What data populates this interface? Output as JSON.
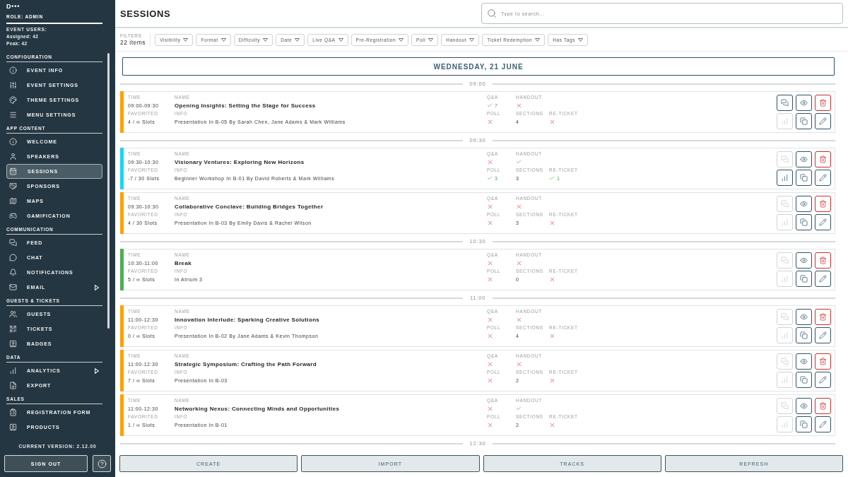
{
  "sidebar": {
    "account": {
      "name": "D•••",
      "role": "ROLE: ADMIN"
    },
    "event_users": {
      "title": "EVENT USERS:",
      "assigned": "Assigned: 42",
      "peak": "Peak: 42"
    },
    "sections": [
      {
        "title": "CONFIGURATION",
        "items": [
          {
            "label": "EVENT INFO",
            "selected": false,
            "submenu": false
          },
          {
            "label": "EVENT SETTINGS",
            "selected": false,
            "submenu": false
          },
          {
            "label": "THEME SETTINGS",
            "selected": false,
            "submenu": false
          },
          {
            "label": "MENU SETTINGS",
            "selected": false,
            "submenu": false
          }
        ]
      },
      {
        "title": "APP CONTENT",
        "items": [
          {
            "label": "WELCOME",
            "selected": false,
            "submenu": false
          },
          {
            "label": "SPEAKERS",
            "selected": false,
            "submenu": false
          },
          {
            "label": "SESSIONS",
            "selected": true,
            "submenu": false
          },
          {
            "label": "SPONSORS",
            "selected": false,
            "submenu": false
          },
          {
            "label": "MAPS",
            "selected": false,
            "submenu": false
          },
          {
            "label": "GAMIFICATION",
            "selected": false,
            "submenu": false
          }
        ]
      },
      {
        "title": "COMMUNICATION",
        "items": [
          {
            "label": "FEED",
            "selected": false,
            "submenu": false
          },
          {
            "label": "CHAT",
            "selected": false,
            "submenu": false
          },
          {
            "label": "NOTIFICATIONS",
            "selected": false,
            "submenu": false
          },
          {
            "label": "EMAIL",
            "selected": false,
            "submenu": true
          }
        ]
      },
      {
        "title": "GUESTS & TICKETS",
        "items": [
          {
            "label": "GUESTS",
            "selected": false,
            "submenu": false
          },
          {
            "label": "TICKETS",
            "selected": false,
            "submenu": false
          },
          {
            "label": "BADGES",
            "selected": false,
            "submenu": false
          }
        ]
      },
      {
        "title": "DATA",
        "items": [
          {
            "label": "ANALYTICS",
            "selected": false,
            "submenu": true
          },
          {
            "label": "EXPORT",
            "selected": false,
            "submenu": false
          }
        ]
      },
      {
        "title": "SALES",
        "items": [
          {
            "label": "REGISTRATION FORM",
            "selected": false,
            "submenu": false
          },
          {
            "label": "PRODUCTS",
            "selected": false,
            "submenu": false
          }
        ]
      }
    ],
    "version": "CURRENT VERSION: 2.12.00",
    "sign_out": "SIGN OUT"
  },
  "header": {
    "title": "SESSIONS",
    "search": {
      "placeholder": "Type to search..."
    }
  },
  "filters": {
    "label": "FILTERS",
    "count": "22 items",
    "chips": [
      {
        "label": "Visibility"
      },
      {
        "label": "Format"
      },
      {
        "label": "Difficulty"
      },
      {
        "label": "Date"
      },
      {
        "label": "Live Q&A"
      },
      {
        "label": "Pre-Registration"
      },
      {
        "label": "Poll"
      },
      {
        "label": "Handout"
      },
      {
        "label": "Ticket Redemption"
      },
      {
        "label": "Has Tags"
      }
    ]
  },
  "day": {
    "title": "WEDNESDAY, 21 JUNE",
    "slots": [
      {
        "time": "09:00",
        "sessions": [
          {
            "color": "#ffa000",
            "time": {
              "label": "TIME",
              "value": "09:00-09:30"
            },
            "favorited": {
              "label": "FAVORITED",
              "value": "4 / ∞ Slots"
            },
            "name": {
              "label": "NAME",
              "value": "Opening Insights: Setting the Stage for Success"
            },
            "info": {
              "label": "INFO",
              "value": "Presentation In B-05 By Sarah Chen, Jane Adams & Mark Williams"
            },
            "qa": {
              "label": "Q&A",
              "on": true,
              "count": "7"
            },
            "handout": {
              "label": "HANDOUT",
              "on": false
            },
            "poll": {
              "label": "POLL",
              "on": false
            },
            "sections": {
              "label": "SECTIONS",
              "value": "4"
            },
            "reticket": {
              "label": "RE-TICKET",
              "on": false
            },
            "actions": [
              {
                "kind": "chat",
                "disabled": false
              },
              {
                "kind": "view",
                "disabled": false
              },
              {
                "kind": "delete",
                "disabled": false
              },
              {
                "kind": "chart",
                "disabled": true
              },
              {
                "kind": "copy",
                "disabled": false
              },
              {
                "kind": "edit",
                "disabled": false
              }
            ]
          }
        ]
      },
      {
        "time": "09:30",
        "sessions": [
          {
            "color": "#1ed2f4",
            "time": {
              "label": "TIME",
              "value": "09:30-10:30"
            },
            "favorited": {
              "label": "FAVORITED",
              "value": "-7 / 30 Slots"
            },
            "name": {
              "label": "NAME",
              "value": "Visionary Ventures: Exploring New Horizons"
            },
            "info": {
              "label": "INFO",
              "value": "Beginner Workshop In B-01 By David Roberts & Mark Williams"
            },
            "qa": {
              "label": "Q&A",
              "on": false
            },
            "handout": {
              "label": "HANDOUT",
              "on": true
            },
            "poll": {
              "label": "POLL",
              "on": true,
              "count": "3"
            },
            "sections": {
              "label": "SECTIONS",
              "value": "3"
            },
            "reticket": {
              "label": "RE-TICKET",
              "on": true,
              "count": "1"
            },
            "actions": [
              {
                "kind": "chat",
                "disabled": true
              },
              {
                "kind": "view",
                "disabled": false
              },
              {
                "kind": "delete",
                "disabled": false
              },
              {
                "kind": "chart",
                "disabled": false
              },
              {
                "kind": "copy",
                "disabled": false
              },
              {
                "kind": "edit",
                "disabled": false
              }
            ]
          },
          {
            "color": "#ffa000",
            "time": {
              "label": "TIME",
              "value": "09:30-10:30"
            },
            "favorited": {
              "label": "FAVORITED",
              "value": "4 / 30 Slots"
            },
            "name": {
              "label": "NAME",
              "value": "Collaborative Conclave: Building Bridges Together"
            },
            "info": {
              "label": "INFO",
              "value": "Presentation In B-03 By Emily Davis & Rachel Wilson"
            },
            "qa": {
              "label": "Q&A",
              "on": false
            },
            "handout": {
              "label": "HANDOUT",
              "on": false
            },
            "poll": {
              "label": "POLL",
              "on": false
            },
            "sections": {
              "label": "SECTIONS",
              "value": "3"
            },
            "reticket": {
              "label": "RE-TICKET",
              "on": false
            },
            "actions": [
              {
                "kind": "chat",
                "disabled": true
              },
              {
                "kind": "view",
                "disabled": false
              },
              {
                "kind": "delete",
                "disabled": false
              },
              {
                "kind": "chart",
                "disabled": true
              },
              {
                "kind": "copy",
                "disabled": false
              },
              {
                "kind": "edit",
                "disabled": false
              }
            ]
          }
        ]
      },
      {
        "time": "10:30",
        "sessions": [
          {
            "color": "#4caf50",
            "time": {
              "label": "TIME",
              "value": "10:30-11:00"
            },
            "favorited": {
              "label": "FAVORITED",
              "value": "5 / ∞ Slots"
            },
            "name": {
              "label": "NAME",
              "value": "Break"
            },
            "info": {
              "label": "INFO",
              "value": "In Atrium 3"
            },
            "qa": {
              "label": "Q&A",
              "on": false
            },
            "handout": {
              "label": "HANDOUT",
              "on": false
            },
            "poll": {
              "label": "POLL",
              "on": false
            },
            "sections": {
              "label": "SECTIONS",
              "value": "0"
            },
            "reticket": {
              "label": "RE-TICKET",
              "on": false
            },
            "actions": [
              {
                "kind": "chat",
                "disabled": true
              },
              {
                "kind": "view",
                "disabled": false
              },
              {
                "kind": "delete",
                "disabled": false
              },
              {
                "kind": "chart",
                "disabled": true
              },
              {
                "kind": "copy",
                "disabled": false
              },
              {
                "kind": "edit",
                "disabled": false
              }
            ]
          }
        ]
      },
      {
        "time": "11:00",
        "sessions": [
          {
            "color": "#ffa000",
            "time": {
              "label": "TIME",
              "value": "11:00-12:30"
            },
            "favorited": {
              "label": "FAVORITED",
              "value": "0 / ∞ Slots"
            },
            "name": {
              "label": "NAME",
              "value": "Innovation Interlude: Sparking Creative Solutions"
            },
            "info": {
              "label": "INFO",
              "value": "Presentation In B-02 By Jane Adams & Kevin Thompson"
            },
            "qa": {
              "label": "Q&A",
              "on": false
            },
            "handout": {
              "label": "HANDOUT",
              "on": false
            },
            "poll": {
              "label": "POLL",
              "on": false
            },
            "sections": {
              "label": "SECTIONS",
              "value": "4"
            },
            "reticket": {
              "label": "RE-TICKET",
              "on": false
            },
            "actions": [
              {
                "kind": "chat",
                "disabled": true
              },
              {
                "kind": "view",
                "disabled": false
              },
              {
                "kind": "delete",
                "disabled": false
              },
              {
                "kind": "chart",
                "disabled": true
              },
              {
                "kind": "copy",
                "disabled": false
              },
              {
                "kind": "edit",
                "disabled": false
              }
            ]
          },
          {
            "color": "#ffa000",
            "time": {
              "label": "TIME",
              "value": "11:00-12:30"
            },
            "favorited": {
              "label": "FAVORITED",
              "value": "7 / ∞ Slots"
            },
            "name": {
              "label": "NAME",
              "value": "Strategic Symposium: Crafting the Path Forward"
            },
            "info": {
              "label": "INFO",
              "value": "Presentation In B-03"
            },
            "qa": {
              "label": "Q&A",
              "on": false
            },
            "handout": {
              "label": "HANDOUT",
              "on": false
            },
            "poll": {
              "label": "POLL",
              "on": false
            },
            "sections": {
              "label": "SECTIONS",
              "value": "2"
            },
            "reticket": {
              "label": "RE-TICKET",
              "on": false
            },
            "actions": [
              {
                "kind": "chat",
                "disabled": true
              },
              {
                "kind": "view",
                "disabled": false
              },
              {
                "kind": "delete",
                "disabled": false
              },
              {
                "kind": "chart",
                "disabled": true
              },
              {
                "kind": "copy",
                "disabled": false
              },
              {
                "kind": "edit",
                "disabled": false
              }
            ]
          },
          {
            "color": "#ffa000",
            "time": {
              "label": "TIME",
              "value": "11:00-12:30"
            },
            "favorited": {
              "label": "FAVORITED",
              "value": "1 / ∞ Slots"
            },
            "name": {
              "label": "NAME",
              "value": "Networking Nexus: Connecting Minds and Opportunities"
            },
            "info": {
              "label": "INFO",
              "value": "Presentation In B-01"
            },
            "qa": {
              "label": "Q&A",
              "on": false
            },
            "handout": {
              "label": "HANDOUT",
              "on": true
            },
            "poll": {
              "label": "POLL",
              "on": false
            },
            "sections": {
              "label": "SECTIONS",
              "value": "2"
            },
            "reticket": {
              "label": "RE-TICKET",
              "on": false
            },
            "actions": [
              {
                "kind": "chat",
                "disabled": true
              },
              {
                "kind": "view",
                "disabled": false
              },
              {
                "kind": "delete",
                "disabled": false
              },
              {
                "kind": "chart",
                "disabled": true
              },
              {
                "kind": "copy",
                "disabled": false
              },
              {
                "kind": "edit",
                "disabled": false
              }
            ]
          }
        ]
      },
      {
        "time": "12:30"
      }
    ]
  },
  "footer_buttons": [
    "CREATE",
    "IMPORT",
    "TRACKS",
    "REFRESH"
  ]
}
